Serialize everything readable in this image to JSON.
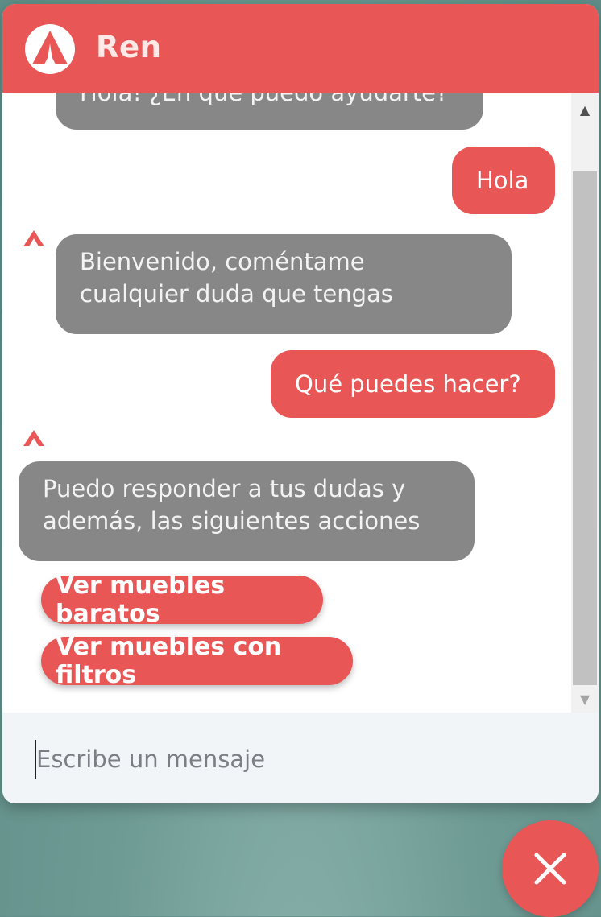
{
  "header": {
    "title": "Ren",
    "logo": "tent-logo"
  },
  "messages": [
    {
      "from": "bot",
      "text": "Hola! ¿En qué puedo ayudarte?"
    },
    {
      "from": "user",
      "text": "Hola"
    },
    {
      "from": "bot",
      "line1": "Bienvenido, coméntame",
      "line2": "cualquier duda que tengas"
    },
    {
      "from": "user",
      "text": "Qué puedes hacer?"
    },
    {
      "from": "bot",
      "line1": "Puedo responder a tus dudas y",
      "line2": "además, las siguientes acciones"
    }
  ],
  "actions": [
    {
      "label": "Ver muebles baratos"
    },
    {
      "label": "Ver muebles con filtros"
    }
  ],
  "composer": {
    "placeholder": "Escribe un mensaje"
  },
  "close_button": {
    "icon": "close-icon"
  },
  "colors": {
    "accent": "#e95656",
    "bot_bubble": "#878787",
    "background": "#6f9b95"
  }
}
